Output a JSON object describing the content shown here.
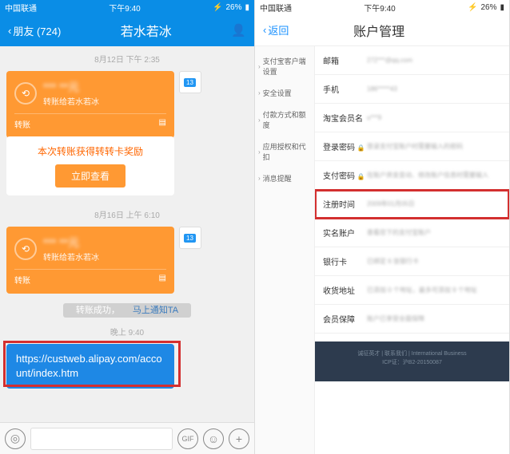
{
  "status": {
    "carrier": "中国联通",
    "time": "下午9:40",
    "battery": "26%"
  },
  "left": {
    "back": "朋友 (724)",
    "title": "若水若冰",
    "ts1": "8月12日 下午 2:35",
    "transfer": {
      "amount": "*** **元",
      "sub": "转账给若水若冰",
      "label": "转账"
    },
    "reward": {
      "text": "本次转账获得转转卡奖励",
      "btn": "立即查看"
    },
    "ts2": "8月16日 上午 6:10",
    "sys": {
      "a": "转账成功，",
      "b": "马上通知TA"
    },
    "ts3": "晚上 9:40",
    "url": "https://custweb.alipay.com/account/index.htm"
  },
  "right": {
    "back": "返回",
    "title": "账户管理",
    "side": [
      "支付宝客户端设置",
      "安全设置",
      "付款方式和额度",
      "应用授权和代扣",
      "消息提醒"
    ],
    "rows": [
      {
        "l": "邮箱",
        "v": "272***@qq.com"
      },
      {
        "l": "手机",
        "v": "186*****43"
      },
      {
        "l": "淘宝会员名",
        "v": "u***9"
      },
      {
        "l": "登录密码",
        "v": "登录支付宝账户时需要输入的密码",
        "lock": true
      },
      {
        "l": "支付密码",
        "v": "在账户资金变动、修改账户信息时需要输入",
        "lock": true
      },
      {
        "l": "注册时间",
        "v": "2009年01月05日",
        "hl": true
      },
      {
        "l": "实名账户",
        "v": "查看您下的支付宝账户"
      },
      {
        "l": "银行卡",
        "v": "已绑定 6 张银行卡"
      },
      {
        "l": "收货地址",
        "v": "已添加 0 个地址，最多可添加 9 个地址"
      },
      {
        "l": "会员保障",
        "v": "账户已享受全面保障"
      }
    ],
    "footer": {
      "l1": "诚征英才 | 联系我们 | International Business",
      "l2": "ICP证：沪B2-20150087"
    }
  }
}
